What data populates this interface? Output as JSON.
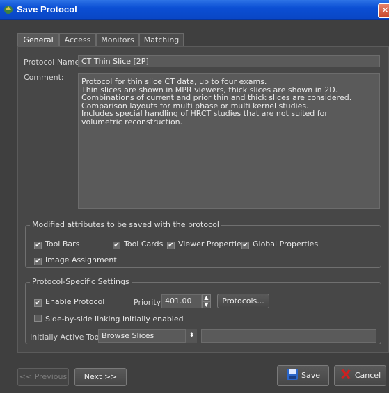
{
  "window": {
    "title": "Save Protocol",
    "close_icon": "close-icon"
  },
  "tabs": [
    {
      "label": "General",
      "active": true
    },
    {
      "label": "Access",
      "active": false
    },
    {
      "label": "Monitors",
      "active": false
    },
    {
      "label": "Matching",
      "active": false
    }
  ],
  "general": {
    "protocol_name_label": "Protocol Name:",
    "protocol_name_value": "CT Thin Slice [2P]",
    "comment_label": "Comment:",
    "comment_value": "Protocol for thin slice CT  data, up to four exams.\nThin slices are shown in MPR viewers, thick slices are shown in 2D.\nCombinations of current and prior thin and thick slices are considered.\nComparison layouts for multi phase or multi kernel studies.\nIncludes special handling of HRCT studies that are not suited for\nvolumetric reconstruction."
  },
  "modified_attributes": {
    "title": "Modified attributes to be saved with the protocol",
    "items": [
      {
        "label": "Tool Bars",
        "checked": true
      },
      {
        "label": "Tool Cards",
        "checked": true
      },
      {
        "label": "Viewer Properties",
        "checked": true
      },
      {
        "label": "Global Properties",
        "checked": true
      },
      {
        "label": "Image Assignment",
        "checked": true
      }
    ]
  },
  "protocol_settings": {
    "title": "Protocol-Specific Settings",
    "enable_protocol": {
      "label": "Enable Protocol",
      "checked": true
    },
    "priority_label": "Priority:",
    "priority_value": "401.00",
    "protocols_button": "Protocols...",
    "side_by_side": {
      "label": "Side-by-side linking initially enabled",
      "checked": false
    },
    "active_tool_label": "Initially Active Tool:",
    "active_tool_value": "Browse Slices",
    "active_tool_extra": ""
  },
  "footer": {
    "previous_label": "<< Previous",
    "next_label": "Next >>",
    "save_label": "Save",
    "cancel_label": "Cancel"
  },
  "colors": {
    "titlebar": "#0b4fd4",
    "background": "#404040",
    "accent_cancel": "#d02020"
  }
}
